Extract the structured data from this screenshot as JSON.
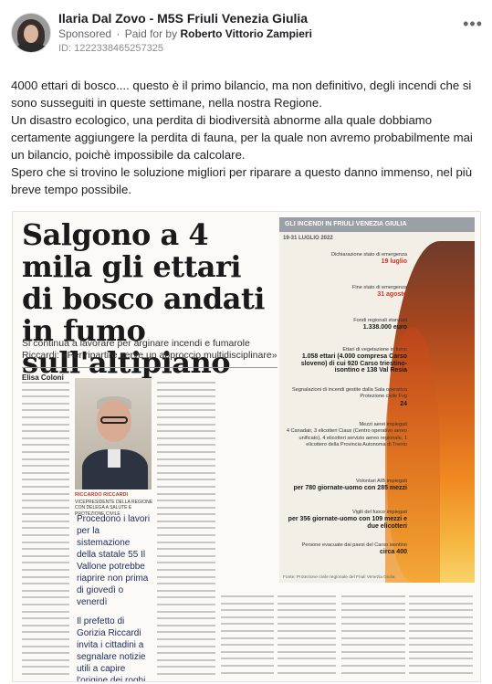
{
  "post": {
    "page_name": "Ilaria Dal Zovo - M5S Friuli Venezia Giulia",
    "sponsored": "Sponsored",
    "paid_for_prefix": "Paid for by",
    "paid_for_by": "Roberto Vittorio Zampieri",
    "ad_id": "ID: 1222338465257325",
    "more_icon": "more-options-icon",
    "paragraphs": [
      "4000 ettari di bosco.... questo è il primo bilancio, ma non definitivo, degli incendi che si sono susseguiti in queste settimane, nella nostra Regione.",
      "Un disastro ecologico, una perdita di biodiversità abnorme alla quale dobbiamo certamente aggiungere la perdita di fauna, per la quale non avremo probabilmente mai un bilancio, poichè impossibile da calcolare.",
      "Spero che si trovino le soluzione migliori per riparare a questo danno immenso, nel più breve tempo possibile."
    ]
  },
  "article": {
    "headline": "Salgono a 4 mila gli ettari di bosco andati in fumo sull'altipiano",
    "subhead": "Si continua a lavorare per arginare incendi e fumarole Riccardi: «Per ripartire serve un approccio multidisciplinare»",
    "author": "Elisa Coloni",
    "photo_caption_name": "RICCARDO RICCARDI",
    "photo_caption_role": "VICEPRESIDENTE DELLA REGIONE CON DELEGA A SALUTE E PROTEZIONE CIVILE",
    "pull_quotes": [
      "Procedono i lavori per la sistemazione della statale 55 Il Vallone potrebbe riaprire non prima di giovedì o venerdì",
      "Il prefetto di Gorizia Riccardi invita i cittadini a segnalare notizie utili a capire l'origine dei roghi e la presenza di piromani"
    ]
  },
  "infographic": {
    "title": "GLI INCENDI IN FRIULI VENEZIA GIULIA",
    "date_range": "19-31 LUGLIO 2022",
    "stats": [
      {
        "label": "Dichiarazione stato di emergenza",
        "value": "19 luglio"
      },
      {
        "label": "Fine stato di emergenza",
        "value": "31 agosto"
      },
      {
        "label": "Fondi regionali stanziati",
        "value": "1.338.000 euro"
      },
      {
        "label": "Ettari di vegetazione in fumo",
        "value": "1.058 ettari (4.000 compresa Carso sloveno) di cui 920 Carso triestino-isontino e 138 Val Resia"
      },
      {
        "label": "Segnalazioni di incendi gestite dalla Sala operativa Protezione civile Fvg",
        "value": "24"
      },
      {
        "label": "Mezzi aerei impiegati",
        "value": "4 Canadair, 3 elicotteri Ciaus (Centro operativo aereo unificato), 4 elicotteri servizio aereo regionale, 1 elicottero della Provincia Autonoma di Trento"
      },
      {
        "label": "Volontari AIB impiegati",
        "value": "per 780 giornate-uomo con 285 mezzi"
      },
      {
        "label": "Vigili del fuoco impiegati",
        "value": "per 356 giornate-uomo con 109 mezzi e due elicotteri"
      },
      {
        "label": "Persone evacuate dai paesi del Carso isontino",
        "value": "circa 400"
      }
    ],
    "footnote": "Fonte: Protezione civile regionale del Friuli Venezia Giulia"
  },
  "colors": {
    "text": "#1c1e21",
    "muted": "#65676b",
    "headline": "#1a1a1a",
    "accent_red": "#c0392b",
    "pull_blue": "#1b2b5e"
  }
}
